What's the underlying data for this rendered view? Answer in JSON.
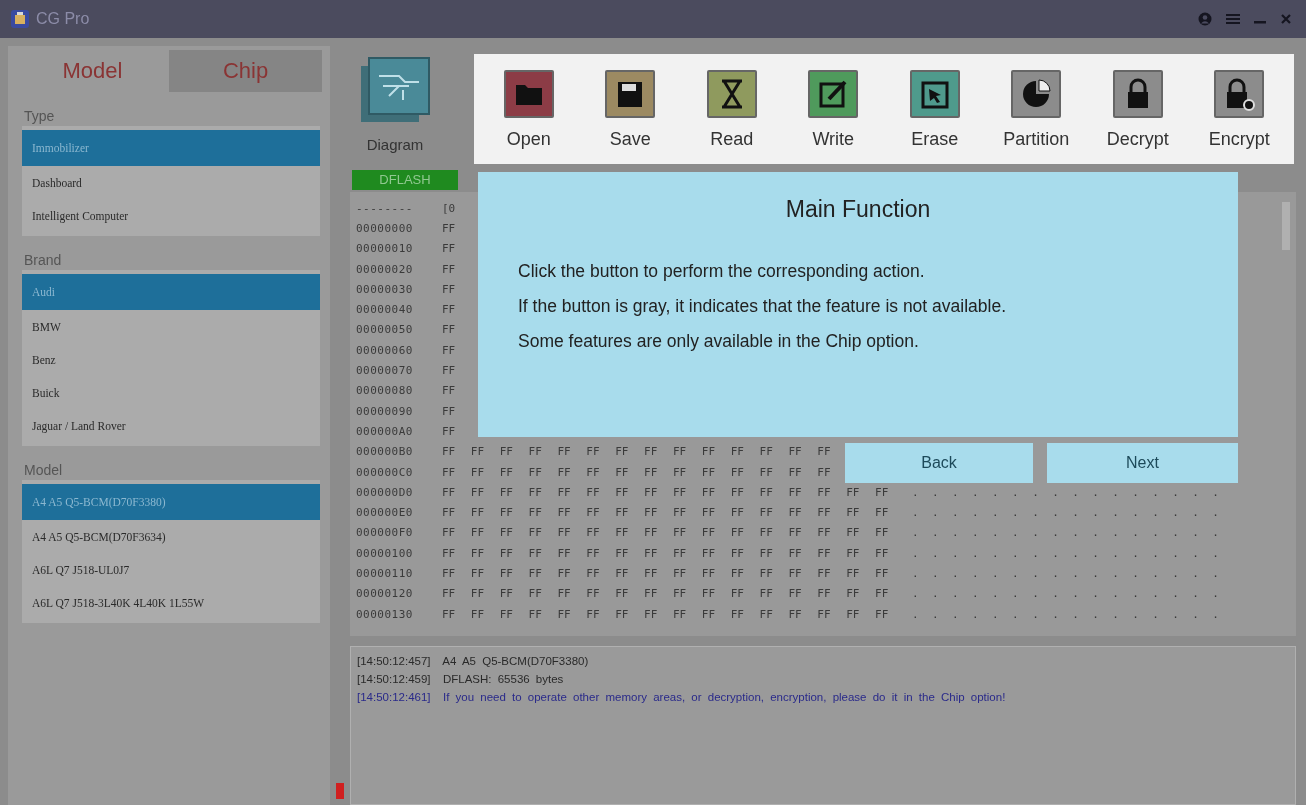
{
  "window": {
    "title": "CG Pro"
  },
  "mode_tabs": [
    {
      "label": "Model",
      "selected": true
    },
    {
      "label": "Chip",
      "selected": false
    }
  ],
  "sections": [
    {
      "title": "Type",
      "items": [
        {
          "label": "Immobilizer",
          "selected": true
        },
        {
          "label": "Dashboard",
          "selected": false
        },
        {
          "label": "Intelligent Computer",
          "selected": false
        }
      ]
    },
    {
      "title": "Brand",
      "items": [
        {
          "label": "Audi",
          "selected": true
        },
        {
          "label": "BMW",
          "selected": false
        },
        {
          "label": "Benz",
          "selected": false
        },
        {
          "label": "Buick",
          "selected": false
        },
        {
          "label": "Jaguar / Land Rover",
          "selected": false
        }
      ]
    },
    {
      "title": "Model",
      "items": [
        {
          "label": "A4 A5 Q5-BCM(D70F3380)",
          "selected": true
        },
        {
          "label": "A4 A5 Q5-BCM(D70F3634)",
          "selected": false
        },
        {
          "label": "A6L Q7 J518-UL0J7",
          "selected": false
        },
        {
          "label": "A6L Q7 J518-3L40K 4L40K 1L55W",
          "selected": false
        }
      ]
    }
  ],
  "diagram": {
    "label": "Diagram"
  },
  "toolbar": [
    {
      "label": "Open",
      "color": "#8c3c46"
    },
    {
      "label": "Save",
      "color": "#9c8a62"
    },
    {
      "label": "Read",
      "color": "#8f9a5e"
    },
    {
      "label": "Write",
      "color": "#4f9a5c"
    },
    {
      "label": "Erase",
      "color": "#4f9a8c"
    },
    {
      "label": "Partition",
      "color": "#8c8c8c"
    },
    {
      "label": "Decrypt",
      "color": "#8c8c8c"
    },
    {
      "label": "Encrypt",
      "color": "#8c8c8c"
    }
  ],
  "memory_tab": "DFLASH",
  "hex": {
    "header": [
      "--------",
      "[0"
    ],
    "rows": [
      {
        "address": "00000000",
        "bytes": "FF"
      },
      {
        "address": "00000010",
        "bytes": "FF"
      },
      {
        "address": "00000020",
        "bytes": "FF"
      },
      {
        "address": "00000030",
        "bytes": "FF"
      },
      {
        "address": "00000040",
        "bytes": "FF"
      },
      {
        "address": "00000050",
        "bytes": "FF"
      },
      {
        "address": "00000060",
        "bytes": "FF"
      },
      {
        "address": "00000070",
        "bytes": "FF"
      },
      {
        "address": "00000080",
        "bytes": "FF"
      },
      {
        "address": "00000090",
        "bytes": "FF"
      },
      {
        "address": "000000A0",
        "bytes": "FF"
      },
      {
        "address": "000000B0",
        "bytes": "FF FF FF FF FF FF FF FF FF FF FF FF FF FF"
      },
      {
        "address": "000000C0",
        "bytes": "FF FF FF FF FF FF FF FF FF FF FF FF FF FF"
      },
      {
        "address": "000000D0",
        "bytes": "FF FF FF FF FF FF FF FF FF FF FF FF FF FF FF FF",
        "ascii": "................"
      },
      {
        "address": "000000E0",
        "bytes": "FF FF FF FF FF FF FF FF FF FF FF FF FF FF FF FF",
        "ascii": "................"
      },
      {
        "address": "000000F0",
        "bytes": "FF FF FF FF FF FF FF FF FF FF FF FF FF FF FF FF",
        "ascii": "................"
      },
      {
        "address": "00000100",
        "bytes": "FF FF FF FF FF FF FF FF FF FF FF FF FF FF FF FF",
        "ascii": "................"
      },
      {
        "address": "00000110",
        "bytes": "FF FF FF FF FF FF FF FF FF FF FF FF FF FF FF FF",
        "ascii": "................"
      },
      {
        "address": "00000120",
        "bytes": "FF FF FF FF FF FF FF FF FF FF FF FF FF FF FF FF",
        "ascii": "................"
      },
      {
        "address": "00000130",
        "bytes": "FF FF FF FF FF FF FF FF FF FF FF FF FF FF FF FF",
        "ascii": "................"
      }
    ]
  },
  "dialog": {
    "title": "Main Function",
    "lines": [
      "Click the button to perform the corresponding action.",
      "If the button is gray, it indicates that the feature is not available.",
      "Some features are only available in the Chip option."
    ],
    "buttons": [
      "Back",
      "Next"
    ]
  },
  "log": [
    {
      "time": "[14:50:12:457]",
      "message": "A4  A5  Q5-BCM(D70F3380)",
      "kind": "info"
    },
    {
      "time": "[14:50:12:459]",
      "message": "DFLASH:  65536  bytes",
      "kind": "info"
    },
    {
      "time": "[14:50:12:461]",
      "message": "If you need to operate other memory areas, or decryption, encryption, please do it in the Chip option!",
      "kind": "notice"
    }
  ]
}
